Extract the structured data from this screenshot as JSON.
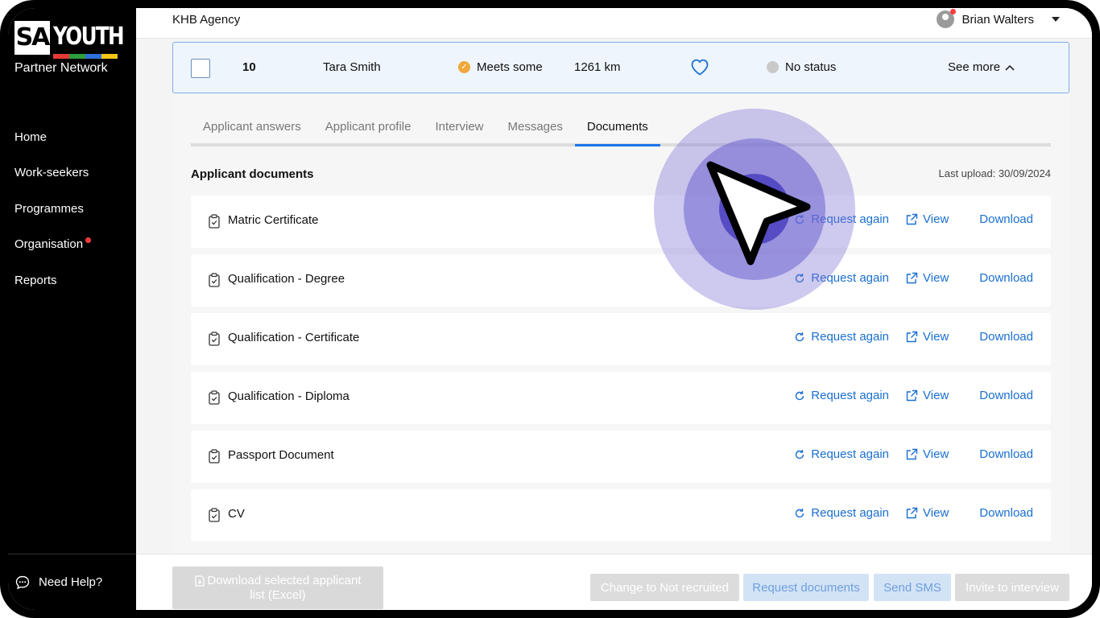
{
  "app": {
    "logo_sa": "SA",
    "logo_youth": "YOUTH",
    "logo_sub": "Partner Network",
    "agency": "KHB Agency",
    "user_name": "Brian Walters",
    "logo_stripe_colors": [
      "#e53935",
      "#2e9e3e",
      "#2f6fd8",
      "#f5c518"
    ]
  },
  "sidebar": {
    "items": [
      {
        "label": "Home",
        "has_dot": false
      },
      {
        "label": "Work-seekers",
        "has_dot": false
      },
      {
        "label": "Programmes",
        "has_dot": false
      },
      {
        "label": "Organisation",
        "has_dot": true
      },
      {
        "label": "Reports",
        "has_dot": false
      }
    ],
    "help_label": "Need Help?"
  },
  "applicant": {
    "number": "10",
    "name": "Tara Smith",
    "criteria": "Meets some",
    "distance": "1261 km",
    "status": "No status",
    "see_more": "See more"
  },
  "tabs": [
    {
      "label": "Applicant answers",
      "active": false
    },
    {
      "label": "Applicant profile",
      "active": false
    },
    {
      "label": "Interview",
      "active": false
    },
    {
      "label": "Messages",
      "active": false
    },
    {
      "label": "Documents",
      "active": true
    }
  ],
  "documents_section": {
    "title": "Applicant documents",
    "last_upload": "Last upload: 30/09/2024",
    "action_request": "Request again",
    "action_view": "View",
    "action_download": "Download",
    "items": [
      {
        "name": "Matric Certificate"
      },
      {
        "name": "Qualification - Degree"
      },
      {
        "name": "Qualification - Certificate"
      },
      {
        "name": "Qualification - Diploma"
      },
      {
        "name": "Passport Document"
      },
      {
        "name": "CV"
      }
    ]
  },
  "bottom_actions": {
    "download_line1": "Download selected applicant",
    "download_line2": "list (Excel)",
    "change_status": "Change to Not recruited",
    "request_documents": "Request documents",
    "send_sms": "Send SMS",
    "invite": "Invite to interview"
  },
  "colors": {
    "accent": "#1a73e8",
    "link": "#1a6fd1",
    "row_highlight_bg": "#eef5fd",
    "row_highlight_border": "#7eaee6",
    "criteria_badge": "#f0a83a",
    "notification_dot": "#ff3b3b",
    "cursor_highlight": "#7b72d6"
  }
}
